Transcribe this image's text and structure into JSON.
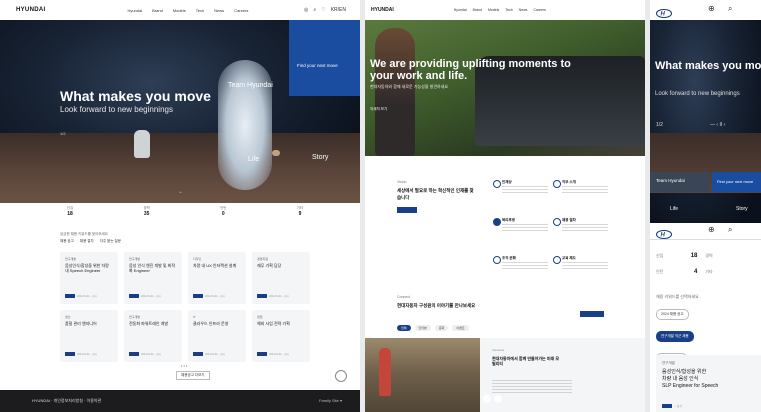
{
  "colors": {
    "brand": "#1a3f8a",
    "accent": "#1a4da0",
    "footer": "#1c1c1e"
  },
  "desktop": {
    "logo": "HYUNDAI",
    "nav": [
      "Hyundai",
      "Brand",
      "Models",
      "Tech",
      "News",
      "Careers"
    ],
    "tools": [
      "◎",
      "⌕",
      "♡",
      "KR/EN"
    ],
    "hero": {
      "title": "What makes you move",
      "subtitle": "Look forward to new beginnings",
      "progress": "1/2",
      "labels": {
        "team": "Team Hyundai",
        "life": "Life",
        "story": "Story"
      },
      "cta": "Find your next move"
    },
    "stats": [
      {
        "l": "신입",
        "v": "18"
      },
      {
        "l": "경력",
        "v": "35"
      },
      {
        "l": "인턴",
        "v": "0"
      },
      {
        "l": "기타",
        "v": "9"
      }
    ],
    "question": "궁금한 채용 키워드를 찾아보세요",
    "chips": [
      "채용 공고",
      "채용 절차",
      "자주 묻는 질문"
    ],
    "cards": [
      {
        "k": "연구개발",
        "t": "음성인식/합성을 위한 차량 내 Speech Engineer"
      },
      {
        "k": "연구개발",
        "t": "음성 인식 엔진 개발 및 최적화 Engineer"
      },
      {
        "k": "디자인",
        "t": "차량 내 UX 인터랙션 설계"
      },
      {
        "k": "경영지원",
        "t": "재무 기획 담당"
      },
      {
        "k": "생산",
        "t": "품질 관리 엔지니어"
      },
      {
        "k": "연구개발",
        "t": "전동화 파워트레인 개발"
      },
      {
        "k": "IT",
        "t": "클라우드 인프라 운영"
      },
      {
        "k": "영업",
        "t": "해외 사업 전략 기획"
      }
    ],
    "card_badge": "채용",
    "card_date": "2024.01.01 ~ 상시",
    "dots": "• • •",
    "more": "채용공고 더보기",
    "footer": {
      "left": "HYUNDAI · 개인정보처리방침 · 이용약관",
      "right": "Family Site ▾"
    }
  },
  "tablet": {
    "logo": "HYUNDAI",
    "nav": [
      "Hyundai",
      "Brand",
      "Models",
      "Tech",
      "News",
      "Careers"
    ],
    "hero": {
      "title": "We are providing uplifting moments to your work and life.",
      "subtitle": "현대자동차와 함께 새로운 가능성을 발견하세요",
      "button": "자세히 보기"
    },
    "intro": {
      "k": "Vision",
      "t": "세상에서 필요로 하는 혁신적인 인재를 찾습니다"
    },
    "services": [
      {
        "t": "인재상",
        "fill": false
      },
      {
        "t": "직무 소개",
        "fill": false
      },
      {
        "t": "복리후생",
        "fill": true
      },
      {
        "t": "채용 절차",
        "fill": false
      },
      {
        "t": "조직 문화",
        "fill": false
      },
      {
        "t": "교육 제도",
        "fill": false
      }
    ],
    "connect": {
      "k": "Connect",
      "t": "현대자동차 구성원의 이야기를 만나보세요"
    },
    "tabs": [
      "전체",
      "인터뷰",
      "문화",
      "이벤트"
    ],
    "article": {
      "k": "Interview",
      "t": "현대자동차에서 함께 만들어가는 미래 모빌리티"
    }
  },
  "mobile": {
    "hero": {
      "title": "What makes you move",
      "subtitle": "Look forward to new beginnings",
      "page": "1/2",
      "controls": "— ‹ II ›",
      "team": "Team Hyundai",
      "find": "Find your next move",
      "life": "Life",
      "story": "Story"
    },
    "stats": [
      {
        "l": "신입",
        "v": "18",
        "u": "경력"
      },
      {
        "l": "인턴",
        "v": "4",
        "u": "기타"
      }
    ],
    "question": "채용 키워드를 선택하세요",
    "chips": [
      {
        "t": "2024 채용 공고",
        "on": false
      },
      {
        "t": "연구개발 직군 채용",
        "on": true
      },
      {
        "t": "자주 묻는 질문",
        "on": false
      }
    ],
    "card": {
      "k": "연구개발",
      "t": "음성인식/합성을 위한\n차량 내 음성 인식\nSLP Engineer for Speech",
      "date": "~ 상시"
    }
  }
}
